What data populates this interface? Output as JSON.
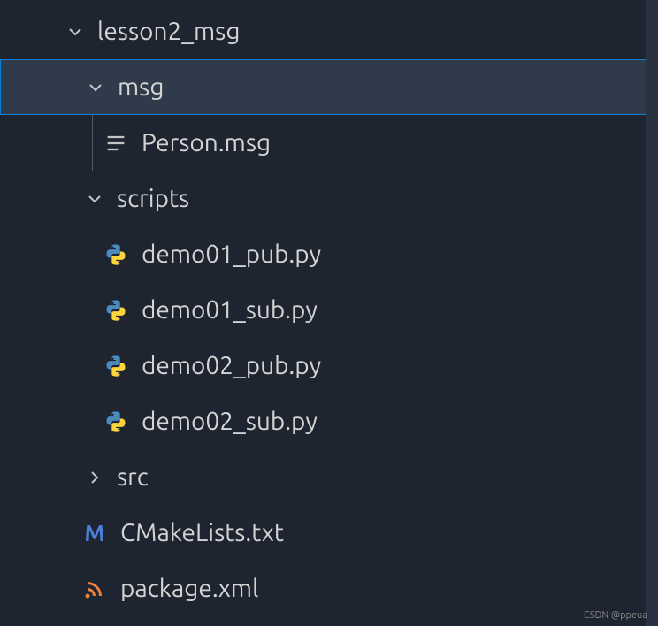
{
  "tree": {
    "root": {
      "label": "lesson2_msg",
      "expanded": true
    },
    "msg_folder": {
      "label": "msg",
      "expanded": true,
      "selected": true
    },
    "person_msg": {
      "label": "Person.msg"
    },
    "scripts_folder": {
      "label": "scripts",
      "expanded": true
    },
    "scripts_files": [
      {
        "label": "demo01_pub.py"
      },
      {
        "label": "demo01_sub.py"
      },
      {
        "label": "demo02_pub.py"
      },
      {
        "label": "demo02_sub.py"
      }
    ],
    "src_folder": {
      "label": "src",
      "expanded": false
    },
    "cmake": {
      "label": "CMakeLists.txt"
    },
    "package_xml": {
      "label": "package.xml"
    }
  },
  "watermark": "CSDN @ppeua"
}
